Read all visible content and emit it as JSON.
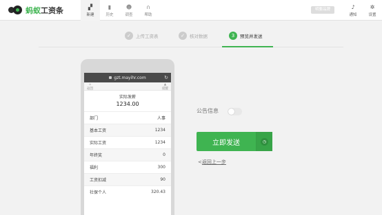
{
  "app": {
    "logo_text_green": "蚂蚁",
    "logo_text_dark": "工资条"
  },
  "nav": {
    "items": [
      {
        "label": "新建",
        "icon": "new-icon",
        "active": true
      },
      {
        "label": "历史",
        "icon": "history-icon",
        "active": false
      },
      {
        "label": "调查",
        "icon": "survey-icon",
        "active": false
      },
      {
        "label": "帮助",
        "icon": "help-icon",
        "active": false
      }
    ],
    "upgrade_label": "明要品牌",
    "notice_label": "通知",
    "settings_label": "设置"
  },
  "steps": {
    "items": [
      {
        "label": "上传工资表",
        "number": "✓"
      },
      {
        "label": "核对数据",
        "number": "✓"
      },
      {
        "label": "预览并发送",
        "number": "3"
      }
    ],
    "active_index": 2
  },
  "preview": {
    "url": "gzt.mayihr.com",
    "toolbar_left": "返回",
    "toolbar_right": "提醒",
    "summary_label": "实际发薪",
    "summary_value": "1234.00",
    "rows": [
      {
        "label": "部门",
        "value": "人事"
      },
      {
        "label": "基本工资",
        "value": "1234"
      },
      {
        "label": "实际工资",
        "value": "1234"
      },
      {
        "label": "年终奖",
        "value": "0"
      },
      {
        "label": "福利",
        "value": "300"
      },
      {
        "label": "工资扣减",
        "value": "90"
      },
      {
        "label": "社保个人",
        "value": "320.43"
      }
    ]
  },
  "panel": {
    "notice_label": "公告信息",
    "notice_enabled": false,
    "send_label": "立即发送",
    "back_label": "返回上一步",
    "back_prefix": "<"
  },
  "colors": {
    "accent": "#3fb451",
    "accent_dark": "#38a448",
    "header_bg": "#ffffff",
    "page_bg": "#f2f2f2"
  }
}
